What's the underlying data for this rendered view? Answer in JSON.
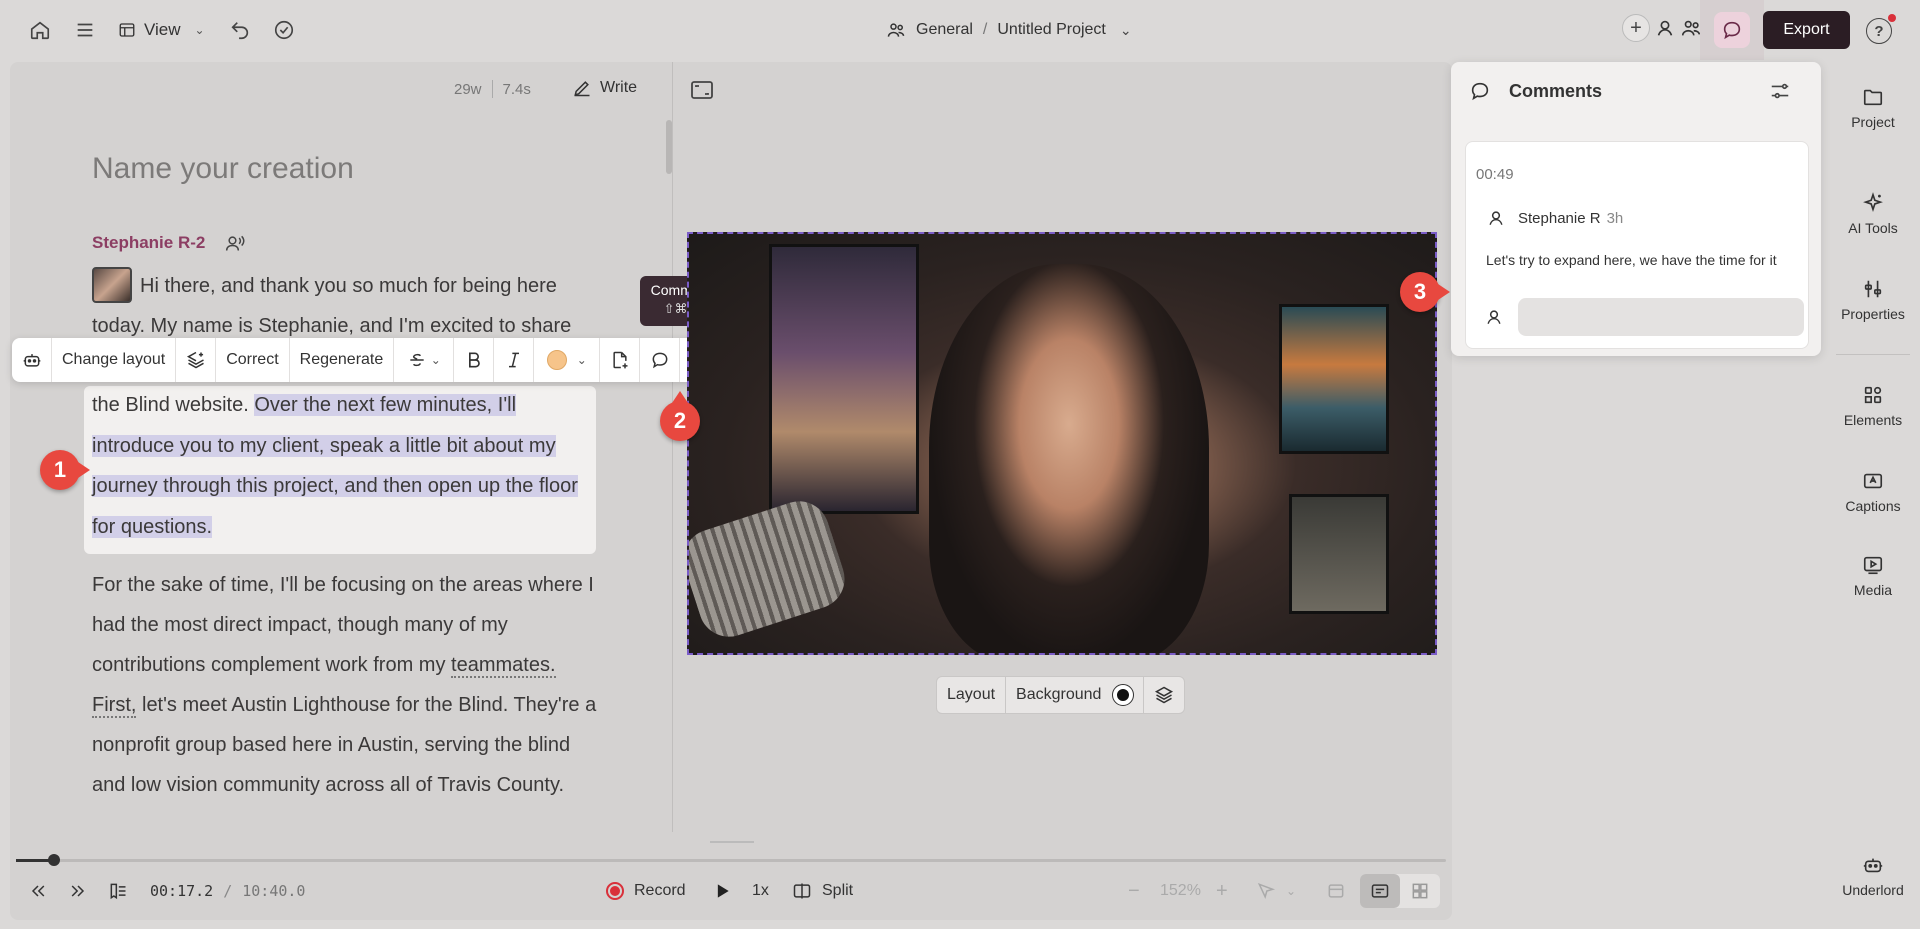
{
  "topbar": {
    "view_label": "View",
    "breadcrumb_team": "General",
    "breadcrumb_sep": "/",
    "breadcrumb_project": "Untitled Project",
    "export_label": "Export",
    "help_label": "?"
  },
  "editor": {
    "word_count": "29w",
    "duration": "7.4s",
    "write_label": "Write",
    "title_placeholder": "Name your creation",
    "speaker_name": "Stephanie R-2",
    "para1": "Hi there, and thank you so much for being here today. My name is Stephanie, and I'm excited to share",
    "para2_plain": "the Blind website. ",
    "para2_highlight": "Over the next few minutes, I'll introduce you to my client, speak a little bit about my journey through this project, and then open up the floor for questions.",
    "para3_a": "For the sake of time, I'll be focusing on the areas where I had the most direct impact, though many of my contributions complement work from my ",
    "para3_dotted": "teammates. First,",
    "para3_b": " let's meet Austin Lighthouse for the Blind. They're a nonprofit group based here in Austin, serving the blind and low vision community across all of Travis County."
  },
  "toolbar": {
    "change_layout": "Change layout",
    "correct": "Correct",
    "regenerate": "Regenerate",
    "highlight_color": "#f6c48a"
  },
  "tooltip": {
    "label": "Comment",
    "shortcut": "⇧⌘M"
  },
  "badges": [
    "1",
    "2",
    "3"
  ],
  "video_controls": {
    "layout": "Layout",
    "background": "Background"
  },
  "comments": {
    "header": "Comments",
    "timestamp": "00:49",
    "author": "Stephanie R",
    "ago": "3h",
    "text": "Let's try to expand here, we have the time for it",
    "reply_placeholder": ""
  },
  "sidebar": {
    "items": [
      {
        "label": "Project",
        "icon": "folder-icon"
      },
      {
        "label": "AI Tools",
        "icon": "sparkle-icon"
      },
      {
        "label": "Properties",
        "icon": "sliders-icon"
      },
      {
        "label": "Elements",
        "icon": "shapes-icon"
      },
      {
        "label": "Captions",
        "icon": "caption-icon"
      },
      {
        "label": "Media",
        "icon": "media-icon"
      },
      {
        "label": "Underlord",
        "icon": "robot-icon"
      }
    ]
  },
  "transport": {
    "current_time": "00:17.2",
    "separator": "/",
    "total_time": "10:40.0",
    "record_label": "Record",
    "speed": "1x",
    "split_label": "Split",
    "zoom": "152%"
  },
  "colors": {
    "accent": "#8c3e63",
    "export_bg": "#2b1d24",
    "highlight": "#d2cfe8",
    "badge": "#e8483f",
    "record": "#d9303a"
  }
}
